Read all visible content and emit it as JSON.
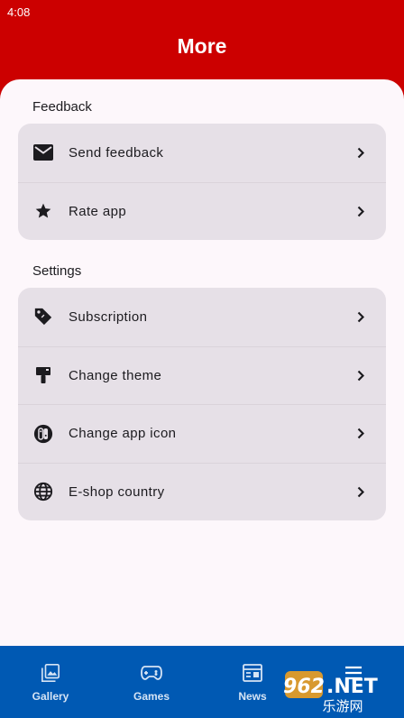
{
  "status_bar": {
    "time": "4:08"
  },
  "header": {
    "title": "More"
  },
  "sections": {
    "feedback": {
      "title": "Feedback",
      "items": [
        {
          "label": "Send feedback",
          "icon": "mail-icon"
        },
        {
          "label": "Rate app",
          "icon": "star-icon"
        }
      ]
    },
    "settings": {
      "title": "Settings",
      "items": [
        {
          "label": "Subscription",
          "icon": "tag-icon"
        },
        {
          "label": "Change theme",
          "icon": "paint-roller-icon"
        },
        {
          "label": "Change app icon",
          "icon": "switch-console-icon"
        },
        {
          "label": "E-shop country",
          "icon": "globe-icon"
        }
      ]
    }
  },
  "bottom_nav": {
    "items": [
      {
        "label": "Gallery",
        "icon": "gallery-icon"
      },
      {
        "label": "Games",
        "icon": "gamepad-icon"
      },
      {
        "label": "News",
        "icon": "news-icon"
      },
      {
        "label": "",
        "icon": "menu-icon"
      }
    ]
  },
  "watermark": {
    "text": "962.NET",
    "subtext": "乐游网"
  },
  "colors": {
    "header_bg": "#cc0000",
    "sheet_bg": "#fdf7fb",
    "card_bg": "#e6e0e7",
    "nav_bg": "#0059b3",
    "nav_text": "#d6e4f5"
  }
}
